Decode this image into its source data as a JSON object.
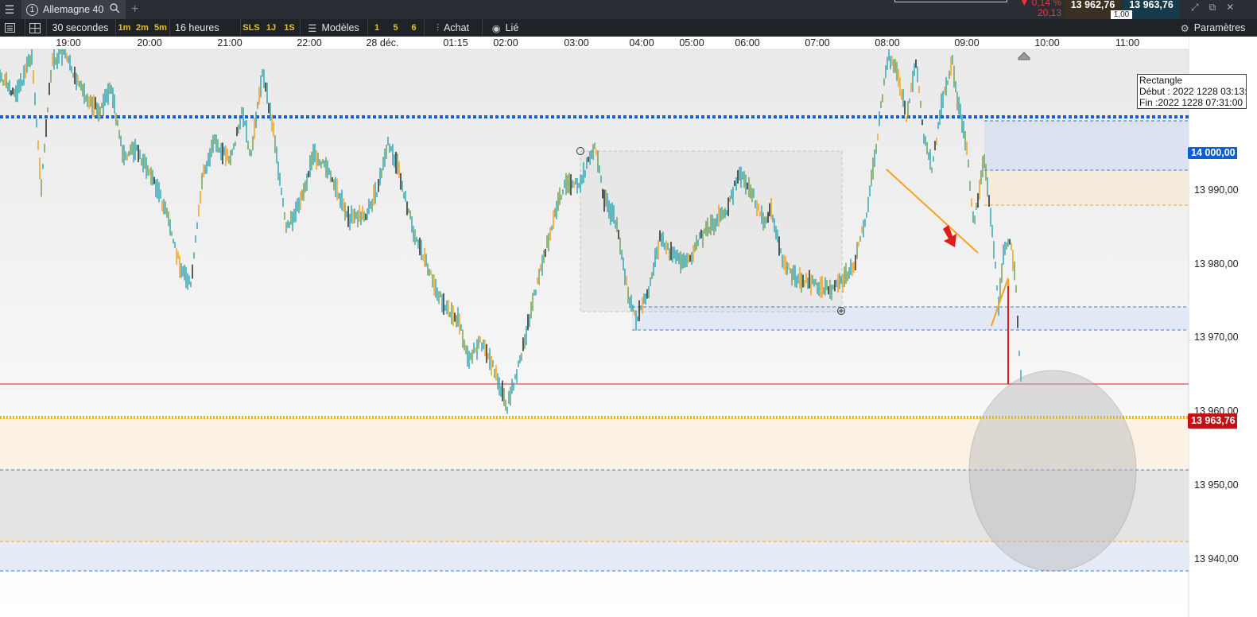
{
  "titlebar": {
    "tab_number": "1",
    "instrument": "Allemagne 40",
    "change_pct": "▼ 0,14 %",
    "change_points": "20,13",
    "bid": "13 962,76",
    "ask": "13 963,76",
    "spread": "1,00"
  },
  "toolbar": {
    "interval": "30 secondes",
    "quick_intervals": [
      "1m",
      "2m",
      "5m"
    ],
    "span": "16 heures",
    "flags": [
      "SLS",
      "1J",
      "1S"
    ],
    "templates_label": "Modèles",
    "template_slots": [
      "1",
      "5",
      "6"
    ],
    "buy_label": "Achat",
    "linked_label": "Lié",
    "settings_label": "Paramètres"
  },
  "chart": {
    "time_labels": [
      "19:00",
      "20:00",
      "21:00",
      "22:00",
      "28 déc.",
      "01:15",
      "02:00",
      "03:00",
      "04:00",
      "05:00",
      "06:00",
      "07:00",
      "08:00",
      "09:00",
      "10:00",
      "11:00"
    ],
    "price_labels": [
      "13 990,00",
      "13 980,00",
      "13 970,00",
      "13 960,00",
      "13 950,00",
      "13 940,00"
    ],
    "level_tag": "14 000,00",
    "current_price_tag": "13 963,76",
    "tooltip": {
      "title": "Rectangle",
      "start": "Début : 2022 1228 03:13:",
      "end": "Fin :2022 1228 07:31:00"
    },
    "colors": {
      "candle_up": "#2aa3b0",
      "candle_alt": "#6b9e52",
      "line": "#f39c12",
      "blue_level": "#0d5fd8",
      "current_price": "#c40f13"
    }
  }
}
